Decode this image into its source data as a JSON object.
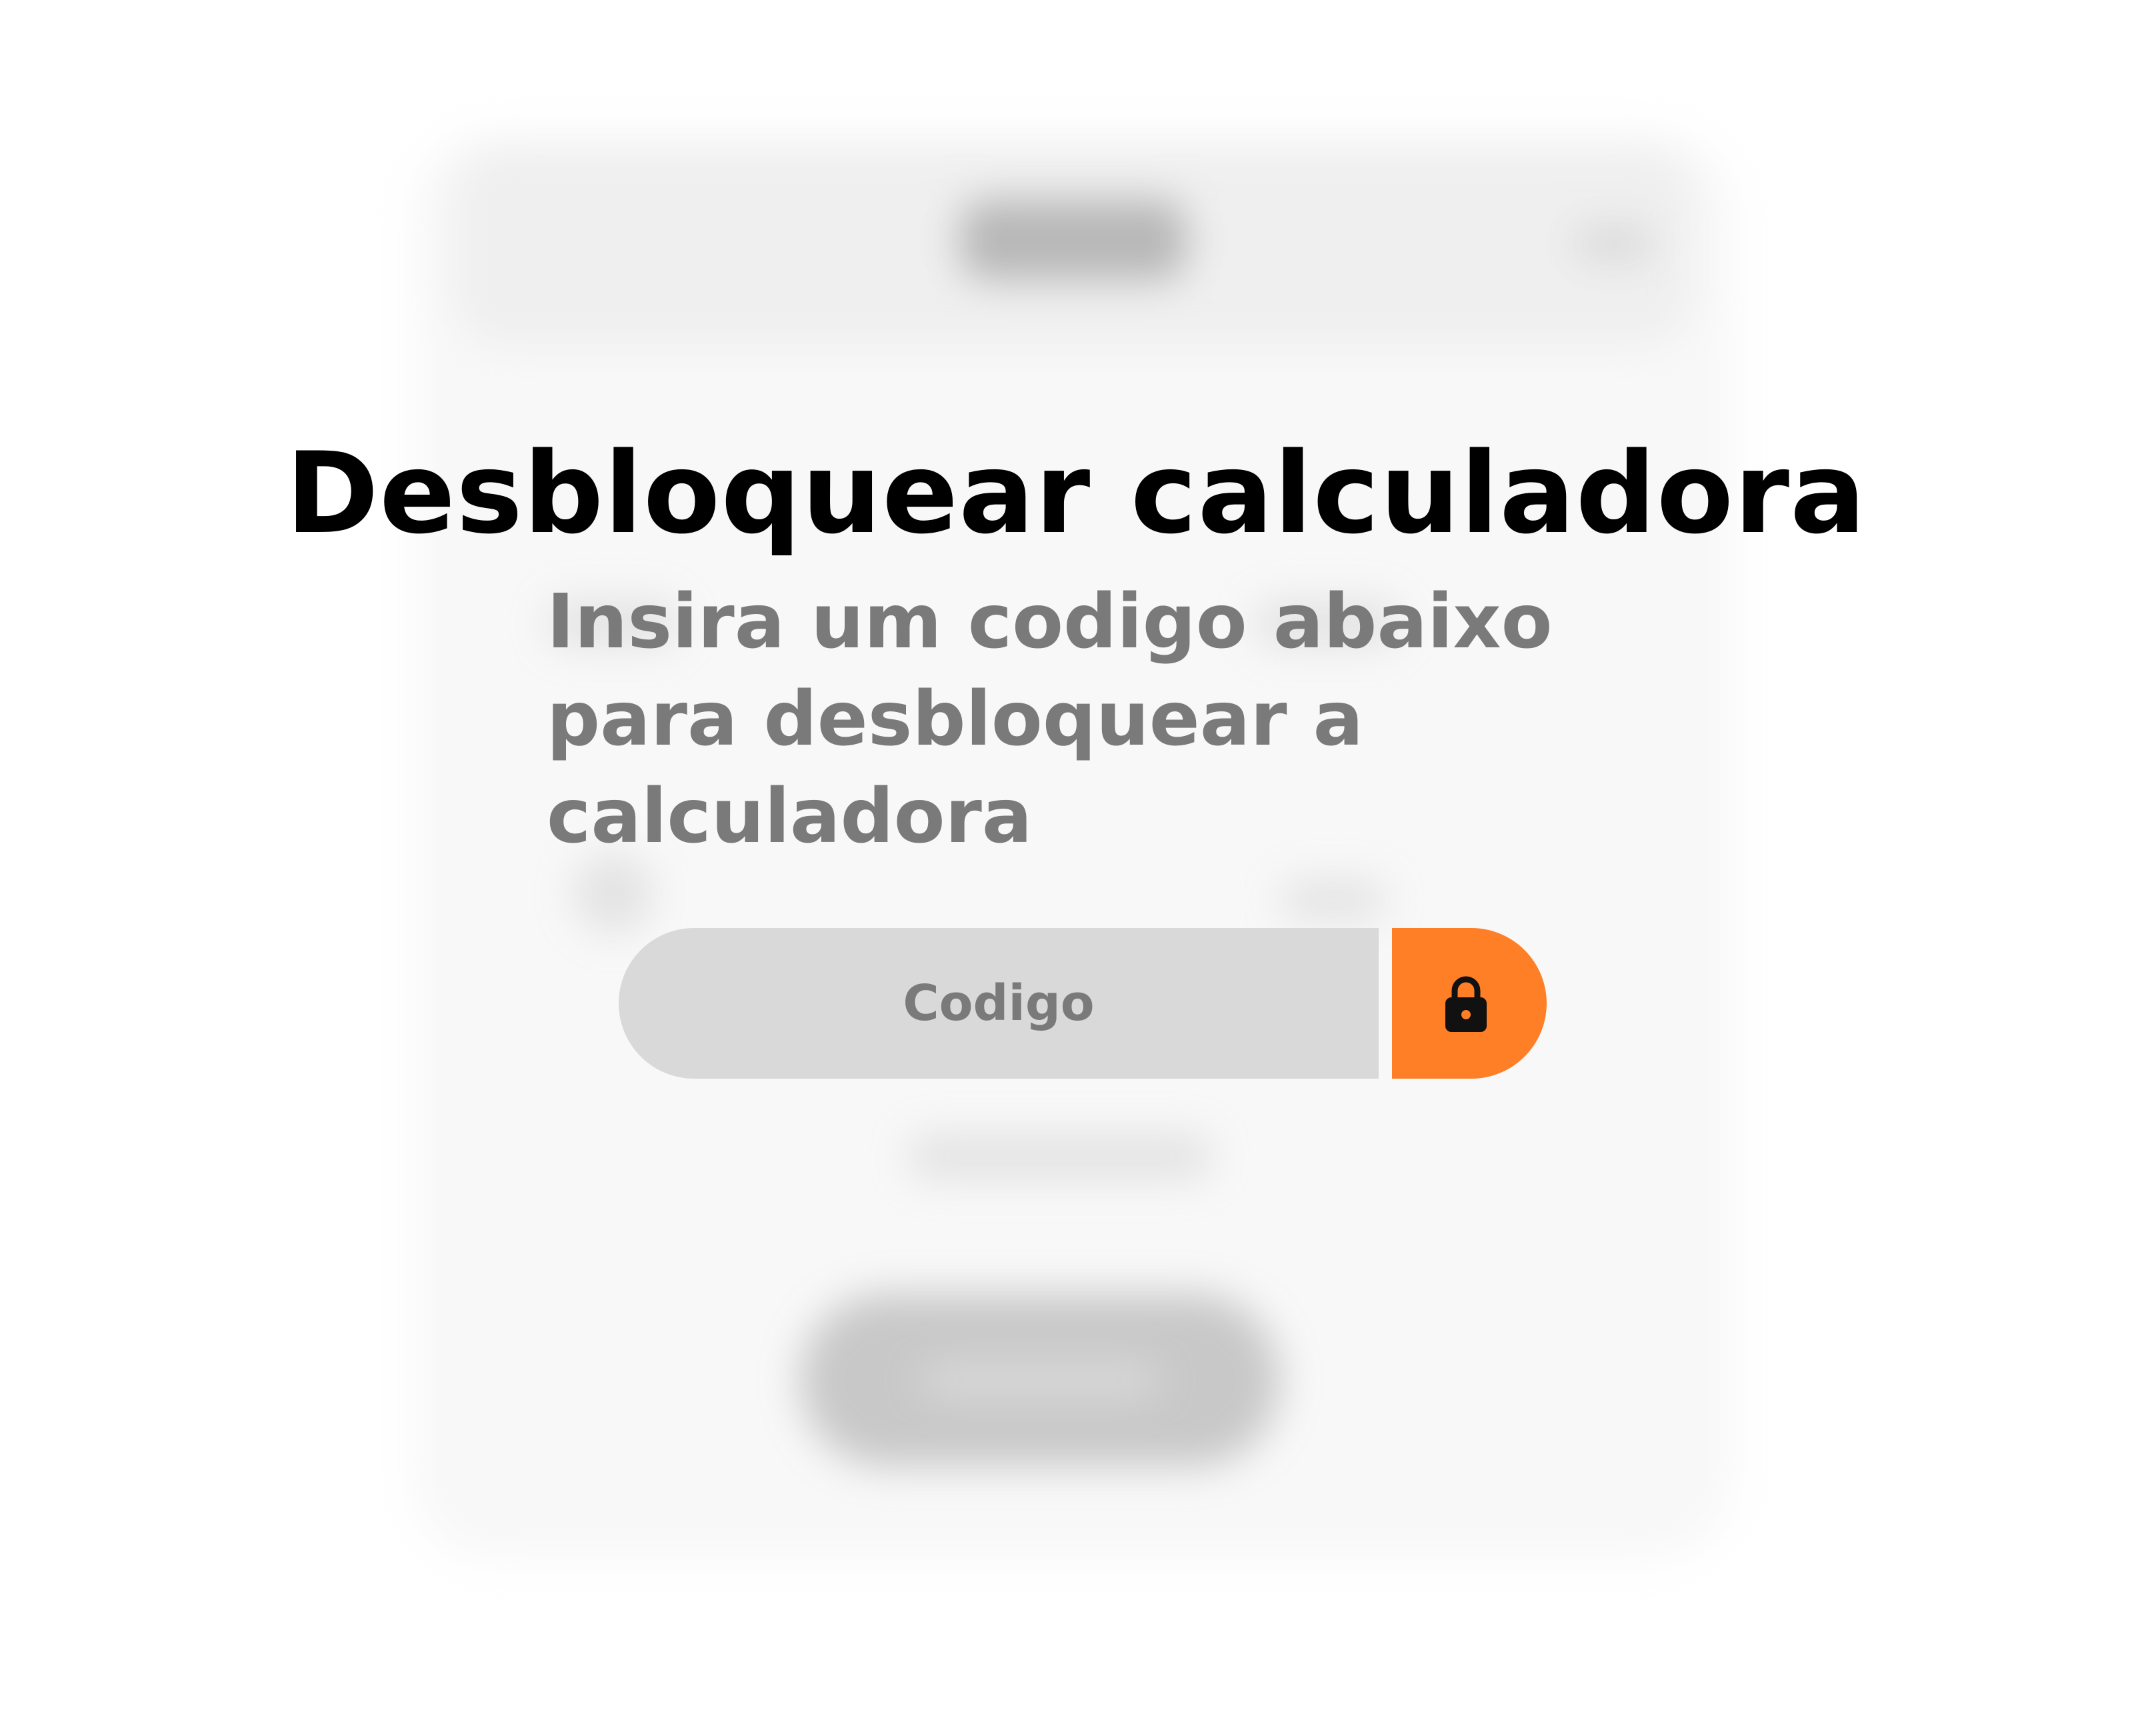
{
  "unlock_dialog": {
    "title": "Desbloquear calculadora",
    "subtitle": "Insira um codigo abaixo para desbloquear a calculadora",
    "code_field": {
      "placeholder": "Codigo",
      "value": ""
    },
    "unlock_button": {
      "icon": "lock-icon"
    }
  },
  "colors": {
    "accent": "#ff7f27",
    "input_background": "#d9d9d9",
    "title_text": "#000000",
    "secondary_text": "#7a7a7a",
    "background": "#ffffff"
  }
}
